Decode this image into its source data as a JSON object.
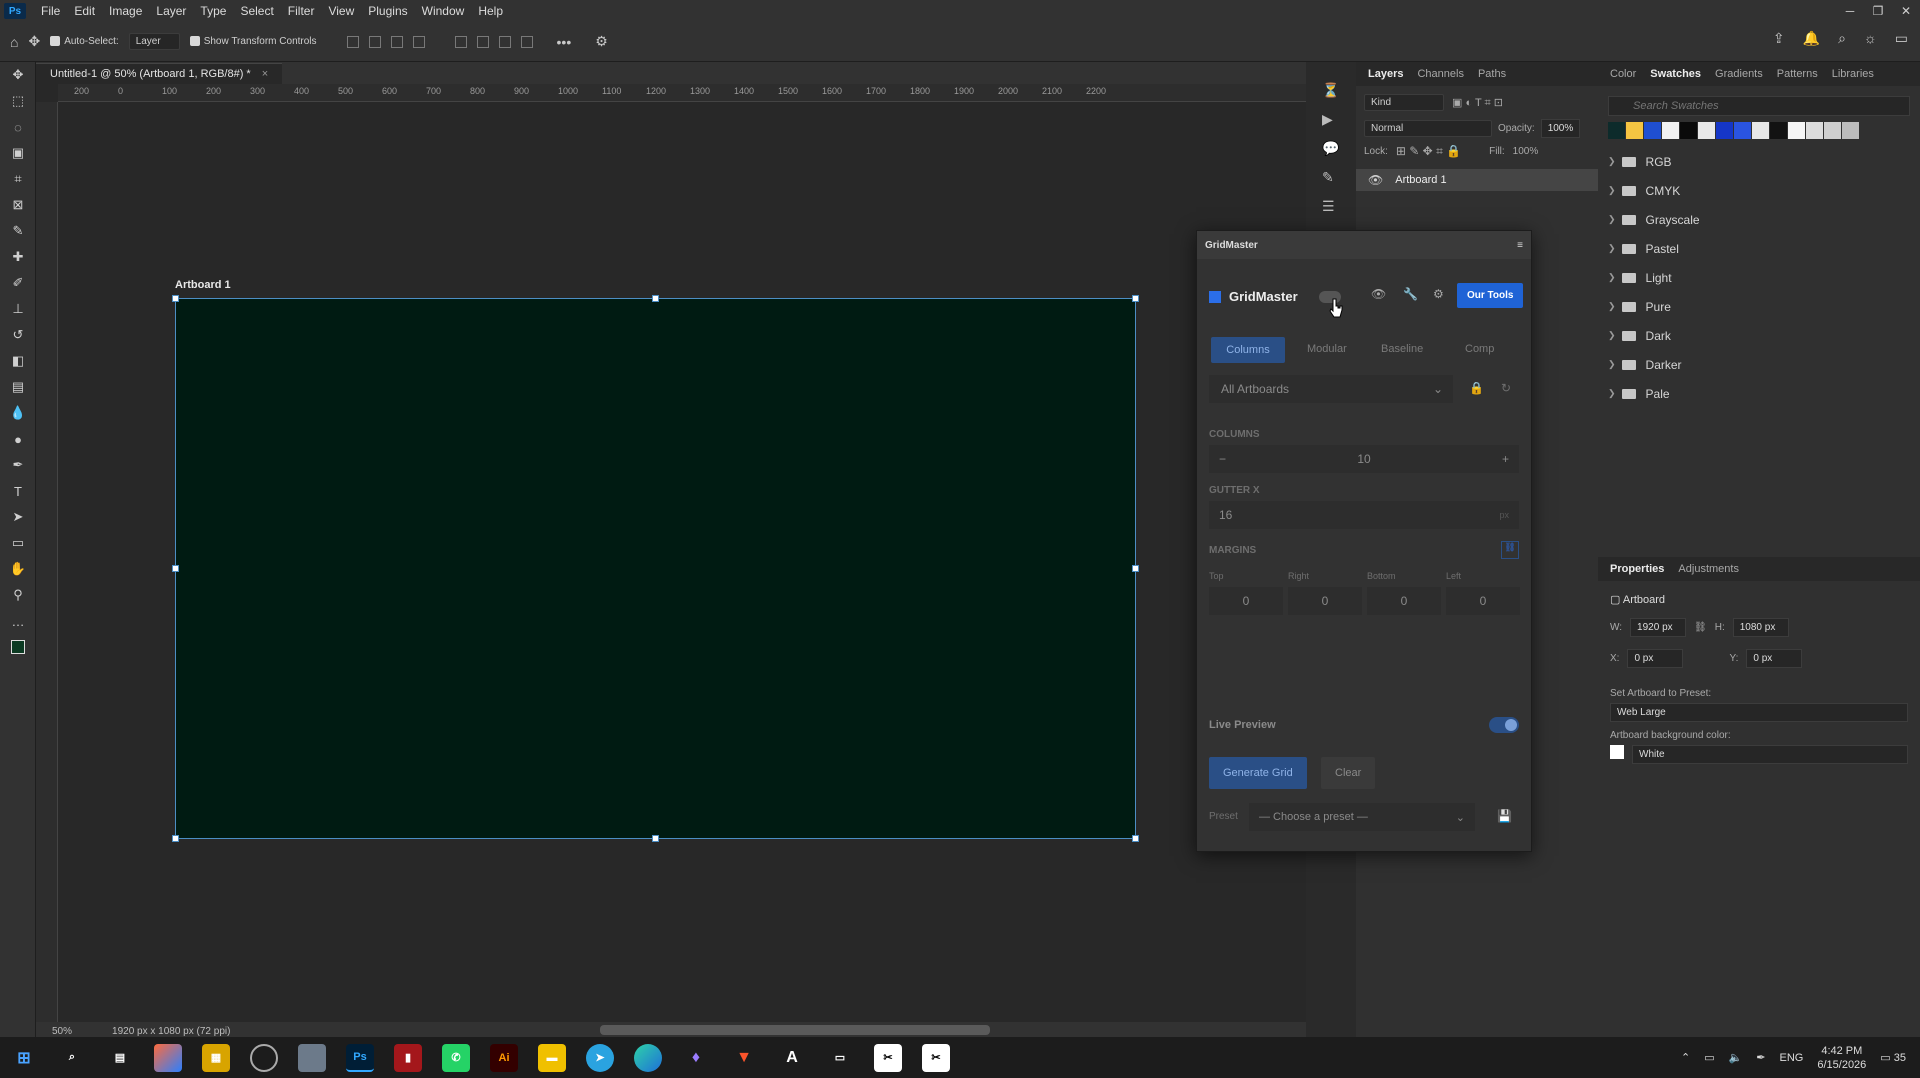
{
  "menubar": {
    "app_icon": "Ps",
    "items": [
      "File",
      "Edit",
      "Image",
      "Layer",
      "Type",
      "Select",
      "Filter",
      "View",
      "Plugins",
      "Window",
      "Help"
    ]
  },
  "options": {
    "auto_select_label": "Auto-Select:",
    "auto_select_value": "Layer",
    "show_transform": "Show Transform Controls"
  },
  "document": {
    "tab_title": "Untitled-1 @ 50% (Artboard 1, RGB/8#) *",
    "tab_close": "×",
    "artboard_label": "Artboard 1",
    "zoom": "50%",
    "info": "1920 px x 1080 px (72 ppi)",
    "artboard_color": "#001b12"
  },
  "ruler": {
    "h_ticks": [
      "200",
      "0",
      "100",
      "200",
      "300",
      "400",
      "500",
      "600",
      "700",
      "800",
      "900",
      "1000",
      "1100",
      "1200",
      "1300",
      "1400",
      "1500",
      "1600",
      "1700",
      "1800",
      "1900",
      "2000",
      "2100",
      "2200"
    ]
  },
  "layers_panel": {
    "tabs": [
      "Layers",
      "Channels",
      "Paths"
    ],
    "kind": "Kind",
    "blend": "Normal",
    "opacity_label": "Opacity:",
    "opacity": "100%",
    "lock_label": "Lock:",
    "fill_label": "Fill:",
    "fill": "100%",
    "layer_name": "Artboard 1"
  },
  "swatches_panel": {
    "tabs": [
      "Color",
      "Swatches",
      "Gradients",
      "Patterns",
      "Libraries"
    ],
    "search_placeholder": "Search Swatches",
    "colors": [
      "#0d2b2b",
      "#f4c542",
      "#1f4fd1",
      "#f2f2f2",
      "#0a0a0a",
      "#e9e9e9",
      "#1536c7",
      "#2a54e0",
      "#e8e8e8",
      "#121212",
      "#f5f5f5",
      "#dcdcdc",
      "#cfcfcf",
      "#bcbcbc"
    ],
    "folders": [
      "RGB",
      "CMYK",
      "Grayscale",
      "Pastel",
      "Light",
      "Pure",
      "Dark",
      "Darker",
      "Pale"
    ]
  },
  "properties": {
    "tabs": [
      "Properties",
      "Adjustments"
    ],
    "type": "Artboard",
    "w_label": "W:",
    "w": "1920 px",
    "h_label": "H:",
    "h": "1080 px",
    "x_label": "X:",
    "x": "0 px",
    "y_label": "Y:",
    "y": "0 px",
    "preset_label": "Set Artboard to Preset:",
    "preset": "Web Large",
    "bg_label": "Artboard background color:",
    "bg": "White"
  },
  "gridmaster": {
    "panel_title": "GridMaster",
    "name": "GridMaster",
    "our_tools": "Our Tools",
    "tabs": [
      "Columns",
      "Modular",
      "Baseline",
      "Comp"
    ],
    "scope": "All Artboards",
    "columns_label": "COLUMNS",
    "minus": "−",
    "columns": "10",
    "plus": "+",
    "gutter_label": "GUTTER X",
    "gutter": "16",
    "gutter_unit": "px",
    "margins_label": "MARGINS",
    "margin_labels": [
      "Top",
      "Right",
      "Bottom",
      "Left"
    ],
    "margins": [
      "0",
      "0",
      "0",
      "0"
    ],
    "live_preview": "Live Preview",
    "generate": "Generate Grid",
    "clear": "Clear",
    "preset_label": "Preset",
    "preset_placeholder": "— Choose a preset —"
  },
  "taskbar": {
    "lang": "ENG",
    "time": "4:42 PM",
    "date": "6/15/2026",
    "notif": "35"
  }
}
